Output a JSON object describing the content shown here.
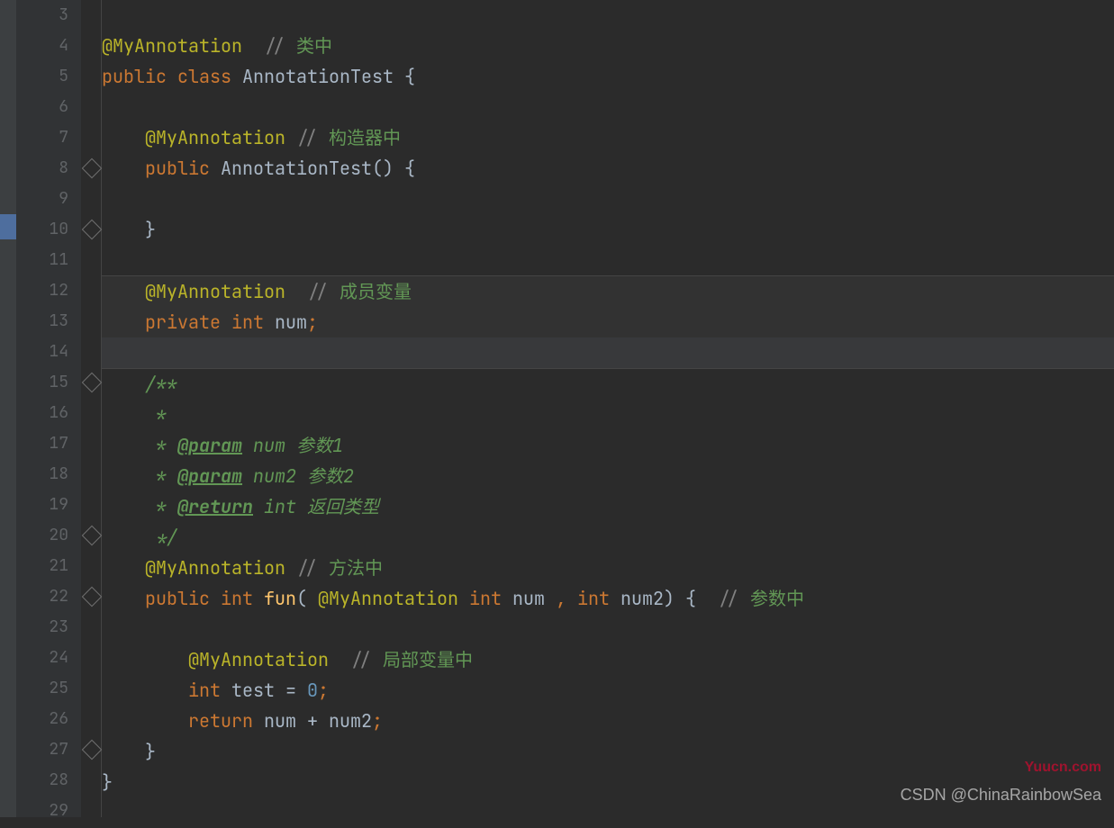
{
  "line_numbers": [
    "3",
    "4",
    "5",
    "6",
    "7",
    "8",
    "9",
    "10",
    "11",
    "12",
    "13",
    "14",
    "15",
    "16",
    "17",
    "18",
    "19",
    "20",
    "21",
    "22",
    "23",
    "24",
    "25",
    "26",
    "27",
    "28",
    "29"
  ],
  "code": {
    "l3": "",
    "l4": {
      "anno": "@MyAnnotation",
      "sep": "  ",
      "c1": "// ",
      "c2": "类中"
    },
    "l5": {
      "kw1": "public ",
      "kw2": "class ",
      "name": "AnnotationTest ",
      "brace": "{"
    },
    "l6": "",
    "l7": {
      "anno": "@MyAnnotation ",
      "c1": "// ",
      "c2": "构造器中"
    },
    "l8": {
      "kw": "public ",
      "name": "AnnotationTest",
      "p1": "(",
      "p2": ") ",
      "brace": "{"
    },
    "l9": "",
    "l10": {
      "brace": "}"
    },
    "l11": "",
    "l12": {
      "anno": "@MyAnnotation",
      "sep": "  ",
      "c1": "// ",
      "c2": "成员变量"
    },
    "l13": {
      "kw1": "private ",
      "kw2": "int ",
      "name": "num",
      "semi": ";"
    },
    "l14": "",
    "l15": {
      "doc": "/**"
    },
    "l16": {
      "doc": " *"
    },
    "l17": {
      "pre": " * ",
      "tag": "@param",
      "rest": " num 参数1"
    },
    "l18": {
      "pre": " * ",
      "tag": "@param",
      "rest": " num2 参数2"
    },
    "l19": {
      "pre": " * ",
      "tag": "@return",
      "rest": " int 返回类型"
    },
    "l20": {
      "doc": " */"
    },
    "l21": {
      "anno": "@MyAnnotation ",
      "c1": "// ",
      "c2": "方法中"
    },
    "l22": {
      "kw1": "public ",
      "kw2": "int ",
      "name": "fun",
      "p1": "( ",
      "anno": "@MyAnnotation ",
      "kw3": "int ",
      "a1": "num ",
      "comma": ", ",
      "kw4": "int ",
      "a2": "num2",
      "p2": ") ",
      "brace": "{",
      "sep": "  ",
      "c1": "// ",
      "c2": "参数中"
    },
    "l23": "",
    "l24": {
      "anno": "@MyAnnotation",
      "sep": "  ",
      "c1": "// ",
      "c2": "局部变量中"
    },
    "l25": {
      "kw": "int ",
      "name": "test ",
      "eq": "= ",
      "val": "0",
      "semi": ";"
    },
    "l26": {
      "kw": "return ",
      "a1": "num ",
      "op": "+ ",
      "a2": "num2",
      "semi": ";"
    },
    "l27": {
      "brace": "}"
    },
    "l28": {
      "brace": "}"
    },
    "l29": ""
  },
  "watermark1": "Yuucn.com",
  "watermark2": "CSDN @ChinaRainbowSea"
}
